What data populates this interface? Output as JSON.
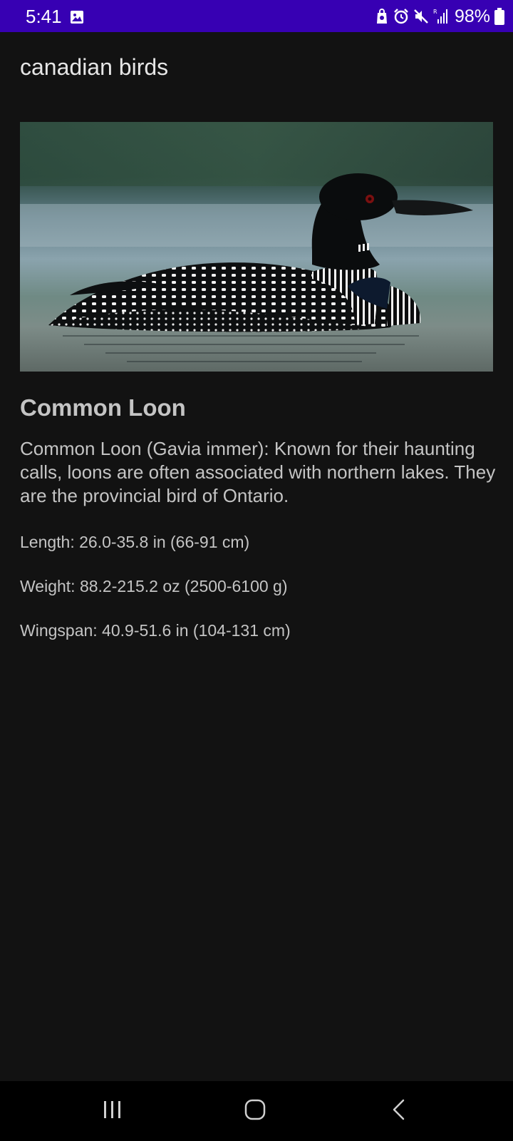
{
  "status_bar": {
    "time": "5:41",
    "battery": "98%",
    "background_color": "#3700b3",
    "icons": [
      "gallery-icon",
      "bag-icon",
      "alarm-icon",
      "mute-icon",
      "signal-icon",
      "battery-icon"
    ]
  },
  "app": {
    "title": "canadian birds"
  },
  "bird": {
    "image_icon": "common-loon-photo",
    "name": "Common Loon",
    "description": "Common Loon (Gavia immer): Known for their haunting calls, loons are often associated with northern lakes. They are the provincial bird of Ontario.",
    "length": "Length: 26.0-35.8 in (66-91 cm)",
    "weight": "Weight: 88.2-215.2 oz (2500-6100 g)",
    "wingspan": "Wingspan: 40.9-51.6 in (104-131 cm)"
  },
  "nav_bar": {
    "icons": [
      "recents-icon",
      "home-icon",
      "back-icon"
    ]
  },
  "colors": {
    "background": "#121212",
    "text_primary": "#e6e6e6",
    "text_secondary": "#c4c4c4"
  }
}
